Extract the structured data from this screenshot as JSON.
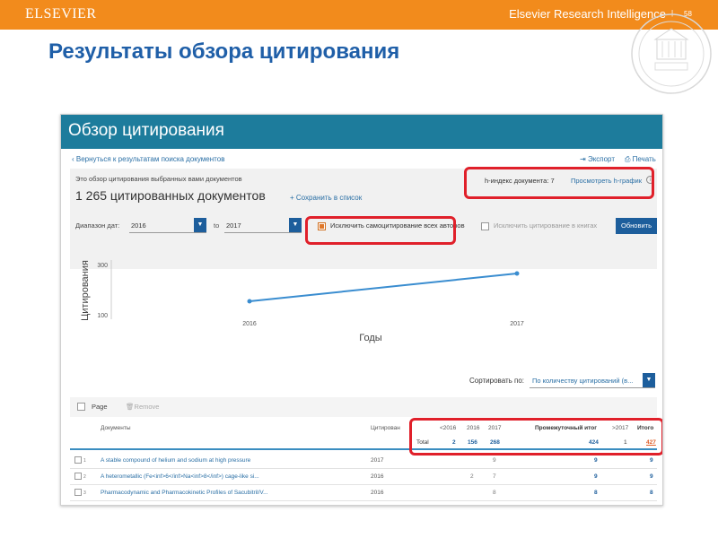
{
  "slide": {
    "logo": "ELSEVIER",
    "top_right": "Elsevier Research Intelligence",
    "page_separator": "|",
    "page_number": "58",
    "title": "Результаты обзора цитирования"
  },
  "colors": {
    "orange_bar": "#f28b1c",
    "title_blue": "#1f5fa8",
    "header_teal": "#1d7c9c",
    "button_blue": "#1d5e9c",
    "highlight_red": "#e0202a",
    "line_blue": "#3a8dd0"
  },
  "screenshot": {
    "header_title": "Обзор цитирования",
    "back_link": "Вернуться к результатам поиска документов",
    "export": "Экспорт",
    "print": "Печать",
    "overview_text": "Это обзор цитирования выбранных вами документов",
    "doc_count": "1 265 цитированных документов",
    "save_to_list": "Сохранить в список",
    "h_index": "h-индекс документа: 7",
    "view_h_graph": "Просмотреть h-график",
    "date_range_label": "Диапазон дат:",
    "date_from": "2016",
    "to_label": "to",
    "date_to": "2017",
    "exclude_self": "Исключить самоцитирование всех авторов",
    "exclude_books": "Исключить цитирование в книгах",
    "update_button": "Обновить",
    "sort_label": "Сортировать по:",
    "sort_value": "По количеству цитирований (в...",
    "page_label": "Page",
    "remove_label": "Remove",
    "table_headers": {
      "documents": "Документы",
      "citations": "Цитирован",
      "lt2016": "<2016",
      "y2016": "2016",
      "y2017": "2017",
      "subtotal": "Промежуточный итог",
      "gt2017": ">2017",
      "total": "Итого"
    },
    "total_row": {
      "label": "Total",
      "lt2016": "2",
      "y2016": "156",
      "y2017": "268",
      "subtotal": "424",
      "gt2017": "1",
      "total": "427"
    },
    "rows": [
      {
        "num": "1",
        "title": "A stable compound of helium and sodium at high pressure",
        "year": "2017",
        "y2016": "",
        "y2017": "9",
        "subtotal": "9",
        "total": "9"
      },
      {
        "num": "2",
        "title": "A heterometallic (Fe<inf>6</inf>Na<inf>8</inf>) cage-like si...",
        "year": "2016",
        "y2016": "2",
        "y2017": "7",
        "subtotal": "9",
        "total": "9"
      },
      {
        "num": "3",
        "title": "Pharmacodynamic and Pharmacokinetic Profiles of Sacubitril/V...",
        "year": "2016",
        "y2016": "",
        "y2017": "8",
        "subtotal": "8",
        "total": "8"
      }
    ]
  },
  "chart_data": {
    "type": "line",
    "x": [
      "2016",
      "2017"
    ],
    "series": [
      {
        "values": [
          157,
          268
        ]
      }
    ],
    "yticks": [
      "300",
      "100"
    ],
    "ylabel": "Цитирования",
    "xlabel": "Годы",
    "ylim": [
      100,
      300
    ],
    "grid": false,
    "legend": "none"
  }
}
